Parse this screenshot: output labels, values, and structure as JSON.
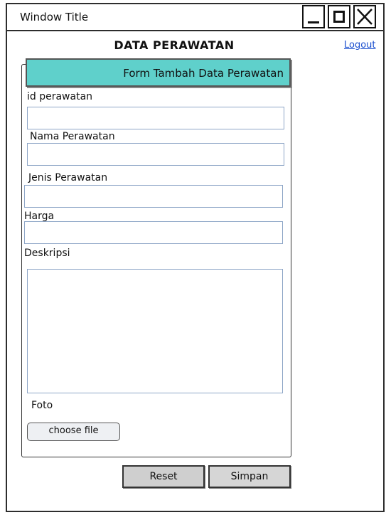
{
  "window": {
    "title": "Window Title"
  },
  "page": {
    "heading": "DATA PERAWATAN",
    "logout": "Logout"
  },
  "form": {
    "header": "Form Tambah Data Perawatan",
    "fields": {
      "id": {
        "label": "id perawatan",
        "value": ""
      },
      "nama": {
        "label": "Nama Perawatan",
        "value": ""
      },
      "jenis": {
        "label": "Jenis Perawatan",
        "value": ""
      },
      "harga": {
        "label": "Harga",
        "value": ""
      },
      "deskripsi": {
        "label": "Deskripsi",
        "value": ""
      },
      "foto": {
        "label": "Foto",
        "button": "choose file"
      }
    }
  },
  "actions": {
    "reset": "Reset",
    "simpan": "Simpan"
  },
  "colors": {
    "header_bg": "#5fd0cb",
    "link": "#1b4fcf",
    "field_border": "#8ea6c7"
  },
  "icons": [
    "minimize-icon",
    "maximize-icon",
    "close-icon"
  ]
}
